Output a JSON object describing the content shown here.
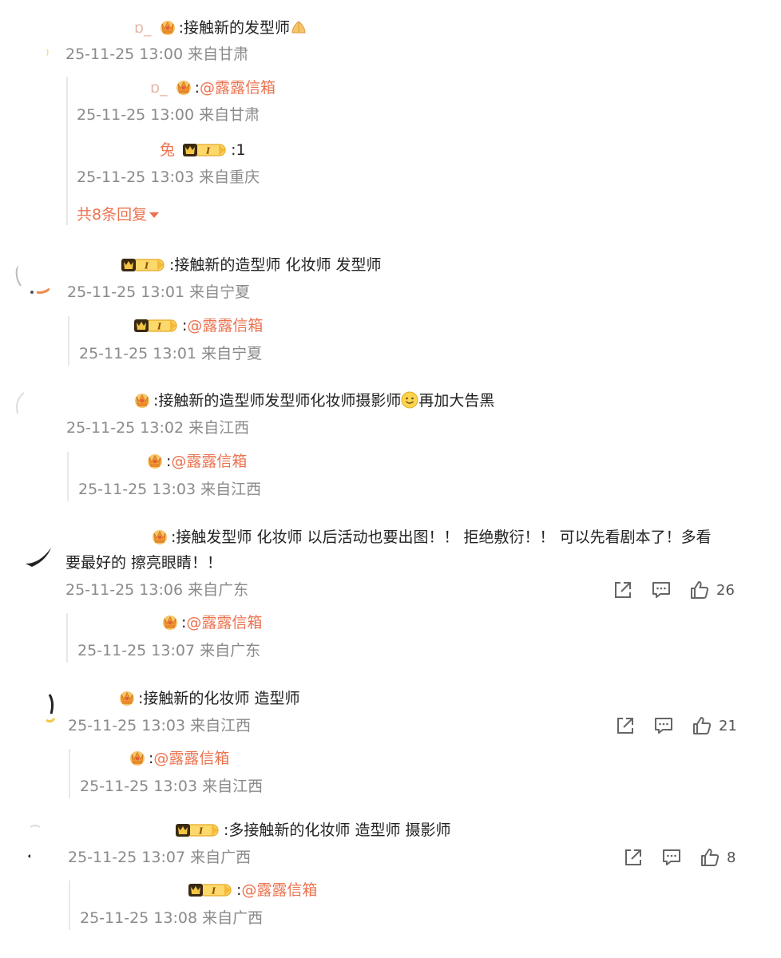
{
  "comments": [
    {
      "user_fragment": "ɒ_",
      "text": "接触新的发型师",
      "time": "25-11-25 13:00",
      "location": "来自甘肃",
      "replies": [
        {
          "user_fragment": "ɒ_",
          "mention": "@露露信箱",
          "time": "25-11-25 13:00",
          "location": "来自甘肃"
        },
        {
          "user_fragment": "兔",
          "text": "1",
          "time": "25-11-25 13:03",
          "location": "来自重庆"
        }
      ],
      "more_replies": "共8条回复"
    },
    {
      "user_fragment": "",
      "text": "接触新的造型师 化妆师 发型师",
      "time": "25-11-25 13:01",
      "location": "来自宁夏",
      "replies": [
        {
          "mention": "@露露信箱",
          "time": "25-11-25 13:01",
          "location": "来自宁夏"
        }
      ]
    },
    {
      "user_fragment": "",
      "text": "接触新的造型师发型师化妆师摄影师",
      "text_after_emoji": "再加大告黑",
      "time": "25-11-25 13:02",
      "location": "来自江西",
      "replies": [
        {
          "mention": "@露露信箱",
          "time": "25-11-25 13:03",
          "location": "来自江西"
        }
      ]
    },
    {
      "user_fragment": "",
      "text_line1": "接触发型师 化妆师 以后活动也要出图！！ 拒绝敷衍！！ 可以先看剧本了！多看",
      "text_line2": "要最好的 擦亮眼睛！！",
      "time": "25-11-25 13:06",
      "location": "来自广东",
      "likes": "26",
      "replies": [
        {
          "mention": "@露露信箱",
          "time": "25-11-25 13:07",
          "location": "来自广东"
        }
      ]
    },
    {
      "user_fragment": "",
      "text": "接触新的化妆师 造型师",
      "time": "25-11-25 13:03",
      "location": "来自江西",
      "likes": "21",
      "replies": [
        {
          "mention": "@露露信箱",
          "time": "25-11-25 13:03",
          "location": "来自江西"
        }
      ]
    },
    {
      "user_fragment": "",
      "text": "多接触新的化妆师 造型师 摄影师",
      "time": "25-11-25 13:07",
      "location": "来自广西",
      "likes": "8",
      "replies": [
        {
          "mention": "@露露信箱",
          "time": "25-11-25 13:08",
          "location": "来自广西"
        }
      ]
    }
  ],
  "separator": ":",
  "icons": {
    "share": "share-icon",
    "comment": "comment-icon",
    "like": "thumbs-up-icon",
    "crown": "crown-badge-icon",
    "vip": "vip-level-badge-icon"
  },
  "colors": {
    "accent": "#eb7350",
    "meta": "#8a8a8a",
    "text": "#222222"
  }
}
